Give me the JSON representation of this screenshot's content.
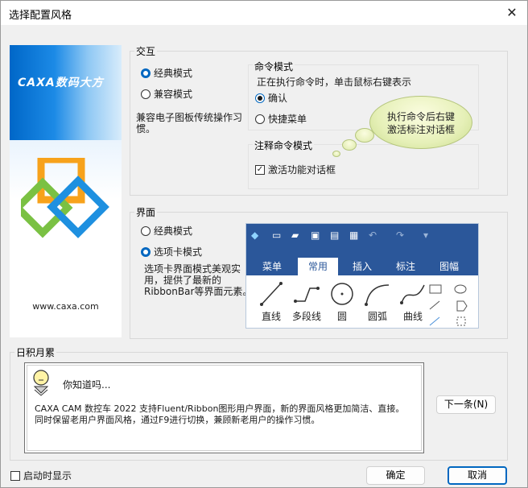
{
  "window": {
    "title": "选择配置风格",
    "close_glyph": "✕"
  },
  "sidebar": {
    "logo_text": "CAXA数码大方",
    "site": "www.caxa.com"
  },
  "interaction": {
    "group_label": "交互",
    "options": [
      "经典模式",
      "兼容模式"
    ],
    "selected": "经典模式",
    "description_lines": [
      "兼容电子图板传统操作习",
      "惯。"
    ],
    "command_mode": {
      "label": "命令模式",
      "hint": "正在执行命令时，单击鼠标右键表示",
      "options": [
        "确认",
        "快捷菜单"
      ],
      "selected": "确认"
    },
    "annotation_mode": {
      "label": "注释命令模式",
      "checkbox_label": "激活功能对话框",
      "checked": true
    },
    "bubble_lines": [
      "执行命令后右键",
      "激活标注对话框"
    ]
  },
  "ui": {
    "group_label": "界面",
    "options": [
      "经典模式",
      "选项卡模式"
    ],
    "selected": "选项卡模式",
    "description_lines": [
      "选项卡界面模式美观实",
      "用，提供了最新的",
      "RibbonBar等界面元素。"
    ],
    "ribbon_preview": {
      "tabs": [
        "菜单",
        "常用",
        "插入",
        "标注",
        "图幅"
      ],
      "active_tab": "常用",
      "tools": [
        "直线",
        "多段线",
        "圆",
        "圆弧",
        "曲线"
      ],
      "accent": "#2b579a"
    }
  },
  "tips": {
    "group_label": "日积月累",
    "heading": "你知道吗...",
    "body_lines": [
      "CAXA CAM 数控车 2022 支持Fluent/Ribbon图形用户界面，新的界面风格更加简洁、直接。",
      "同时保留老用户界面风格，通过F9进行切换，兼顾新老用户的操作习惯。"
    ],
    "next_button": "下一条(N)"
  },
  "footer": {
    "show_on_startup_label": "启动时显示",
    "show_on_startup_checked": false,
    "ok": "确定",
    "cancel": "取消"
  }
}
